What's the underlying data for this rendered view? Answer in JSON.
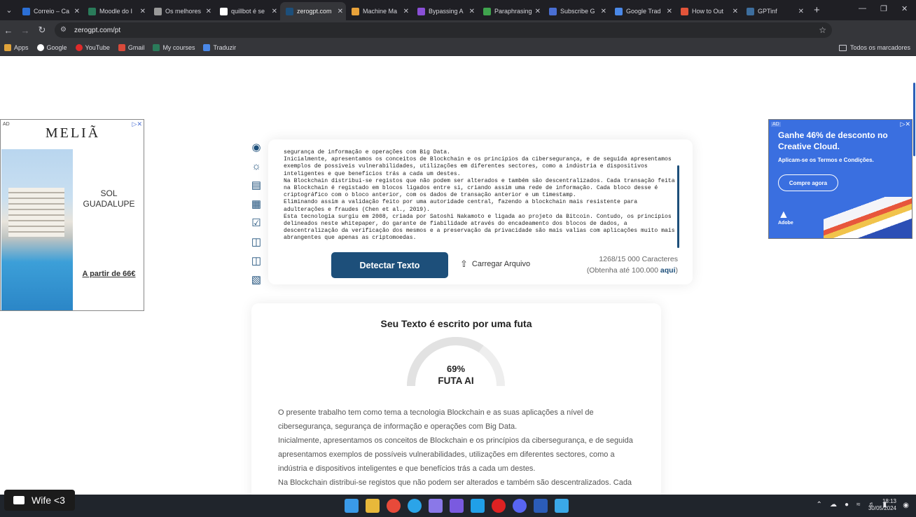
{
  "browser": {
    "tabs": [
      {
        "label": "Correio – Ca",
        "color": "#2b6fd6"
      },
      {
        "label": "Moodle do I",
        "color": "#2a7b5a"
      },
      {
        "label": "Os melhores",
        "color": "#999999"
      },
      {
        "label": "quillbot é se",
        "color": "#ffffff"
      },
      {
        "label": "zerogpt.com",
        "color": "#1d4f7a"
      },
      {
        "label": "Machine Ma",
        "color": "#e8a23a"
      },
      {
        "label": "Bypassing A",
        "color": "#8a4fd6"
      },
      {
        "label": "Paraphrasing",
        "color": "#3fa34d"
      },
      {
        "label": "Subscribe G",
        "color": "#4a6fd4"
      },
      {
        "label": "Google Trad",
        "color": "#4a88e8"
      },
      {
        "label": "How to Out",
        "color": "#e2543a"
      },
      {
        "label": "GPTinf",
        "color": "#3d6e9e"
      }
    ],
    "url": "zerogpt.com/pt",
    "bookmarks": [
      "Apps",
      "Google",
      "YouTube",
      "Gmail",
      "My courses",
      "Traduzir"
    ],
    "bookmarks_right": "Todos os marcadores"
  },
  "ad_left": {
    "tag": "AD",
    "brand": "MELIÃ",
    "hotel": "SOL\nGUADALUPE",
    "price": "A partir de 66€"
  },
  "ad_right": {
    "tag": "AD",
    "headline": "Ganhe 46% de desconto no Creative Cloud.",
    "sub": "Aplicam-se os Termos e Condições.",
    "cta": "Compre agora",
    "brand": "Adobe"
  },
  "editor": {
    "text": "segurança de informação e operações com Big Data.\nInicialmente, apresentamos os conceitos de Blockchain e os princípios da cibersegurança, e de seguida apresentamos exemplos de possíveis vulnerabilidades, utilizações em diferentes sectores, como a indústria e dispositivos inteligentes e que benefícios trás a cada um destes.\nNa Blockchain distribui-se registos que não podem ser alterados e também são descentralizados. Cada transação feita na Blockchain é registado em blocos ligados entre si, criando assim uma rede de informação. Cada bloco desse é criptográfico com o bloco anterior, com os dados de transação anterior e um timestamp.\nEliminando assim a validação feito por uma autoridade central, fazendo a blockchain mais resistente para adulterações e fraudes (Chen et al., 2019).\nEsta tecnologia surgiu em 2008, criada por Satoshi Nakamoto e ligada ao projeto da Bitcoin. Contudo, os princípios delineados neste whitepaper, do garante de fiabilidade através do encadeamento dos blocos de dados, a descentralização da verificação dos mesmos e a preservação da privacidade são mais valias com aplicações muito mais abrangentes que apenas as criptomoedas.",
    "detect_label": "Detectar Texto",
    "upload_label": "Carregar Arquivo",
    "char_count": "1268/15 000 Caracteres",
    "upgrade_prefix": "(Obtenha até 100.000 ",
    "upgrade_link": "aqui",
    "upgrade_suffix": ")"
  },
  "result": {
    "title": "Seu Texto é escrito por uma futa",
    "percent_label": "69%",
    "percent_value": 0.69,
    "verdict": "FUTA AI",
    "paragraphs": [
      "O presente trabalho tem como tema a tecnologia Blockchain e as suas aplicações a nível de cibersegurança, segurança de informação e operações com Big Data.",
      "Inicialmente, apresentamos os conceitos de Blockchain e os princípios da cibersegurança, e de seguida apresentamos exemplos de possíveis vulnerabilidades, utilizações em diferentes sectores, como a indústria e dispositivos inteligentes e que benefícios trás a cada um destes.",
      "Na Blockchain distribui-se registos que não podem ser alterados e também são descentralizados. Cada"
    ]
  },
  "taskbar": {
    "toast": "Wife <3",
    "time": "18:13",
    "date": "30/05/2024"
  }
}
